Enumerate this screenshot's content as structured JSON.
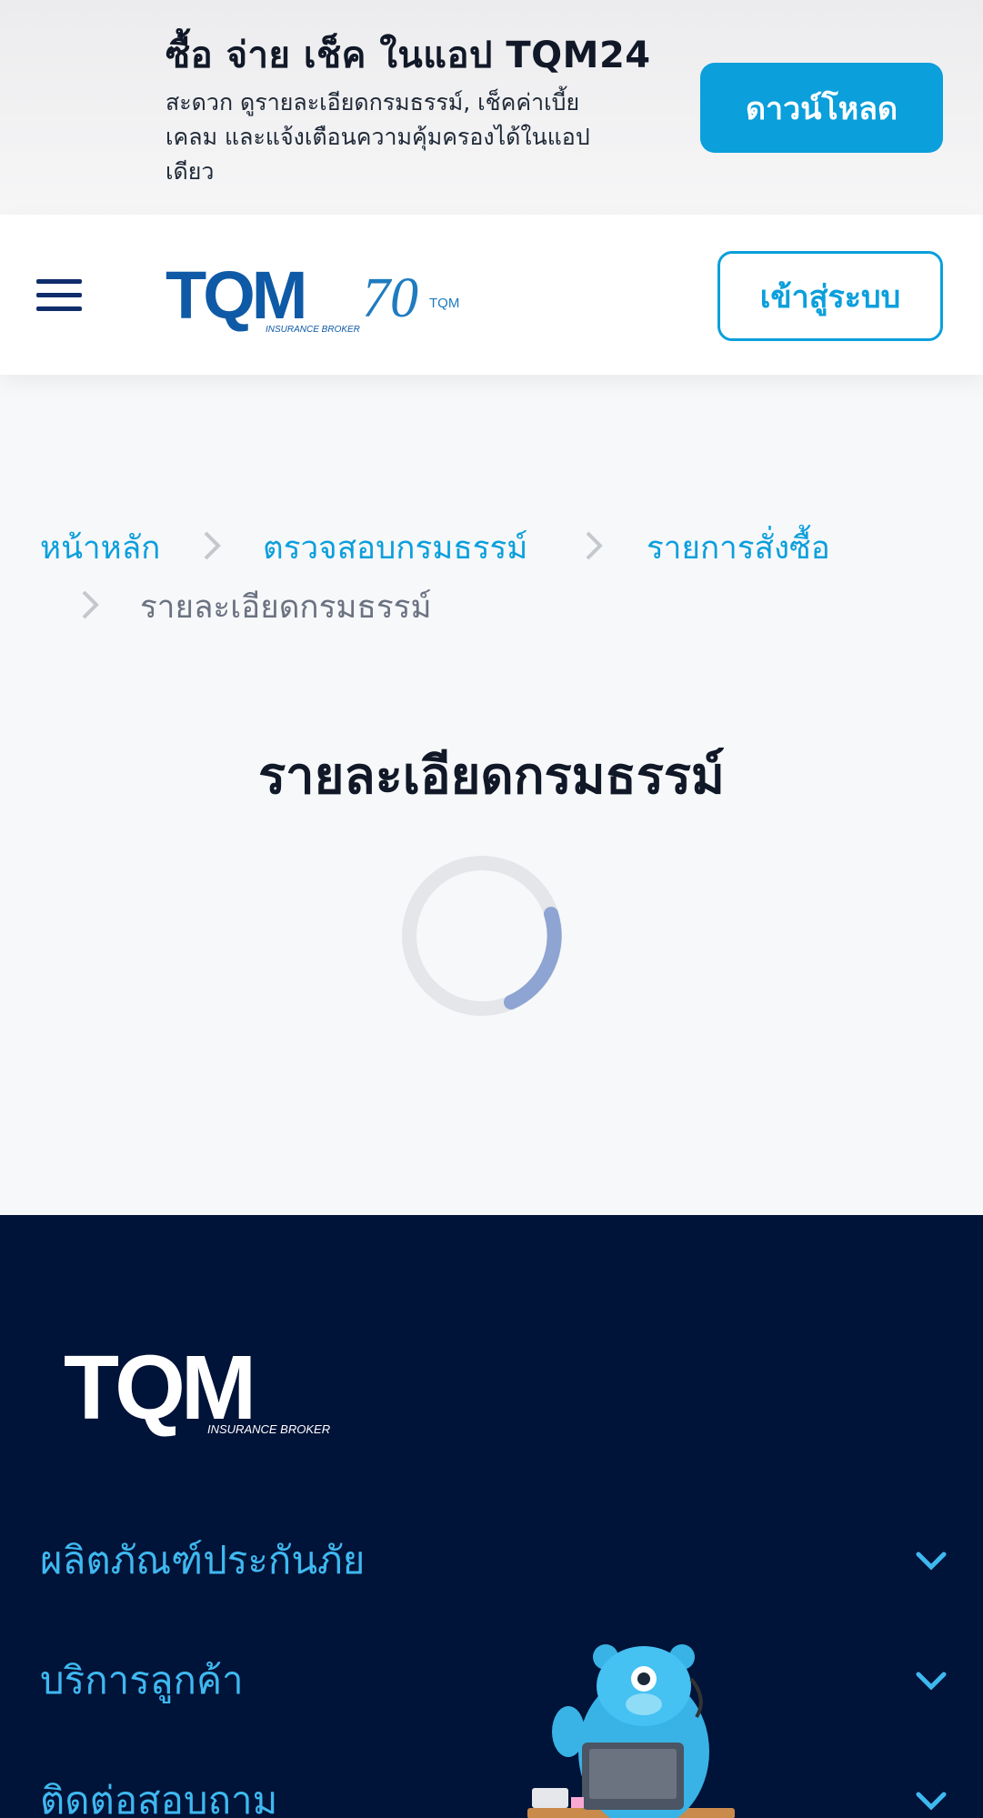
{
  "app_banner": {
    "title": "ซื้อ จ่าย เช็ค ในแอป TQM24",
    "description": "สะดวก ดูรายละเอียดกรมธรรม์, เช็คค่าเบี้ย เคลม และแจ้งเตือนความคุ้มครองได้ในแอปเดียว",
    "download_label": "ดาวน์โหลด"
  },
  "header": {
    "login_label": "เข้าสู่ระบบ",
    "logo_text": "TQM",
    "logo_subtext": "INSURANCE BROKER",
    "anniversary_text": "70",
    "anniversary_small": "TQM"
  },
  "breadcrumb": {
    "items": [
      "หน้าหลัก",
      "ตรวจสอบกรมธรรม์",
      "รายการสั่งซื้อ"
    ],
    "current": "รายละเอียดกรมธรรม์"
  },
  "page": {
    "title": "รายละเอียดกรมธรรม์"
  },
  "footer": {
    "logo_text": "TQM",
    "logo_subtext": "INSURANCE BROKER",
    "menu": [
      "ผลิตภัณฑ์ประกันภัย",
      "บริการลูกค้า",
      "ติดต่อสอบถาม"
    ]
  },
  "colors": {
    "brand_blue": "#0b9fdc",
    "navy": "#0f2d6b",
    "footer_bg": "#001338",
    "footer_link": "#3fb8f0"
  }
}
